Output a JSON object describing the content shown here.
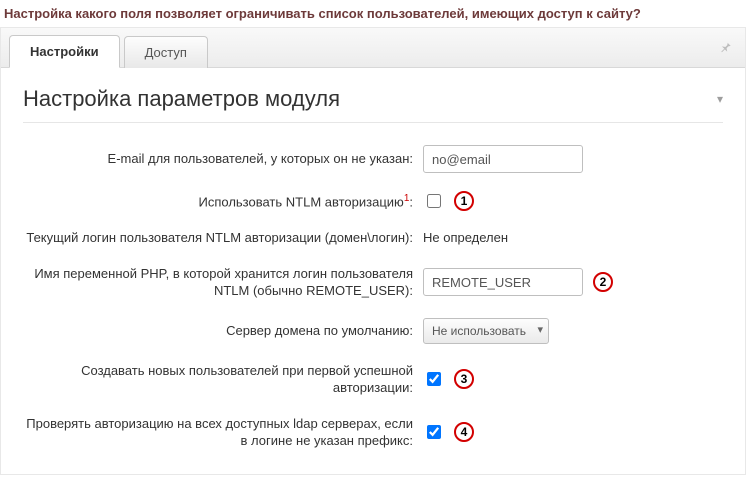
{
  "question": "Настройка какого поля позволяет ограничивать список пользователей, имеющих доступ к сайту?",
  "tabs": {
    "settings": "Настройки",
    "access": "Доступ"
  },
  "panel_title": "Настройка параметров модуля",
  "rows": {
    "email": {
      "label": "E-mail для пользователей, у которых он не указан:",
      "value": "no@email"
    },
    "ntlm_use": {
      "label": "Использовать NTLM авторизацию",
      "sup": "1",
      "colon": ":",
      "checked": false,
      "marker": "1"
    },
    "ntlm_current": {
      "label": "Текущий логин пользователя NTLM авторизации (домен\\логин):",
      "value": "Не определен"
    },
    "php_var": {
      "label": "Имя переменной PHP, в которой хранится логин пользователя NTLM (обычно REMOTE_USER):",
      "value": "REMOTE_USER",
      "marker": "2"
    },
    "domain_server": {
      "label": "Сервер домена по умолчанию:",
      "selected": "Не использовать"
    },
    "create_users": {
      "label": "Создавать новых пользователей при первой успешной авторизации:",
      "checked": true,
      "marker": "3"
    },
    "check_ldap": {
      "label": "Проверять авторизацию на всех доступных ldap серверах, если в логине не указан префикс:",
      "checked": true,
      "marker": "4"
    }
  }
}
